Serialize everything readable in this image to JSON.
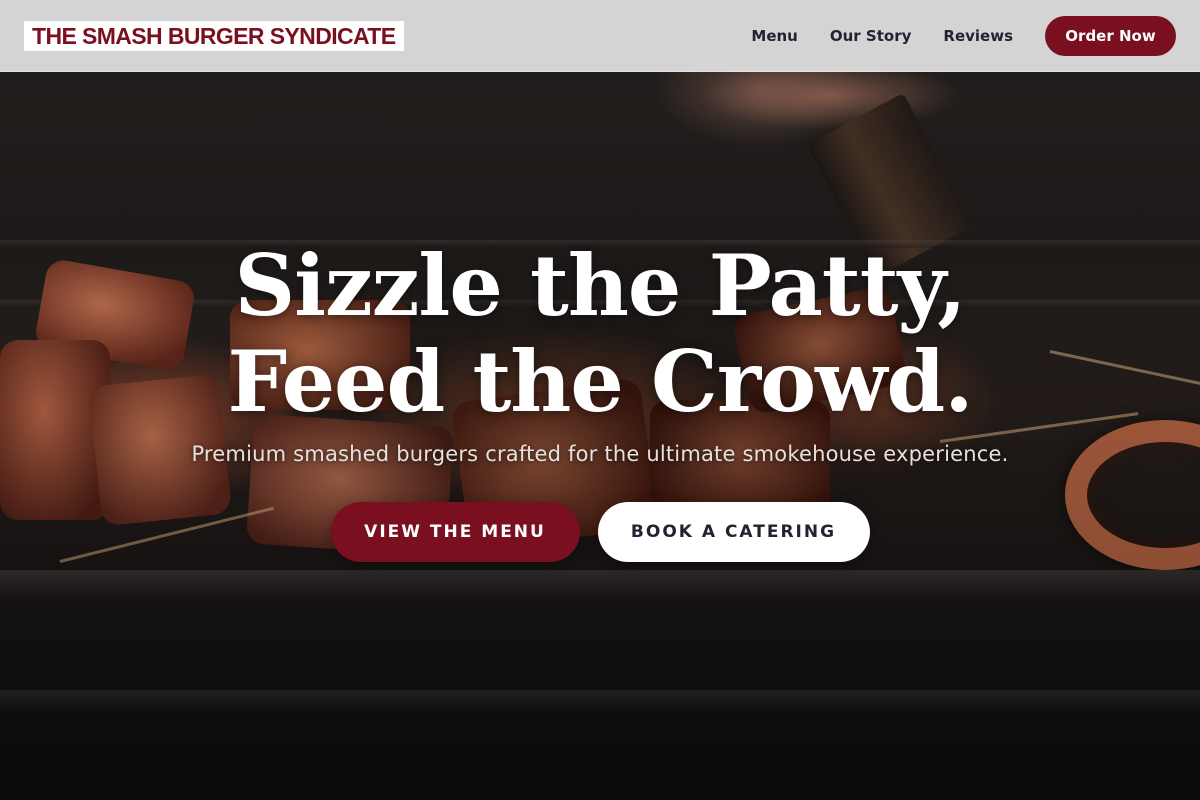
{
  "header": {
    "logo_text": "THE SMASH BURGER SYNDICATE",
    "nav": [
      {
        "label": "Menu"
      },
      {
        "label": "Our Story"
      },
      {
        "label": "Reviews"
      }
    ],
    "order_button": "Order Now"
  },
  "hero": {
    "headline_line1": "Sizzle the Patty,",
    "headline_line2": "Feed the Crowd.",
    "subheadline": "Premium smashed burgers crafted for the ultimate smokehouse experience.",
    "primary_cta": "VIEW THE MENU",
    "secondary_cta": "BOOK A CATERING",
    "background_image": "grilled-meat-skewers-photo"
  },
  "colors": {
    "brand": "#7a0f1f",
    "header_bg": "#e2e2e2",
    "nav_text": "#1f2430",
    "hero_text": "#ffffff"
  }
}
